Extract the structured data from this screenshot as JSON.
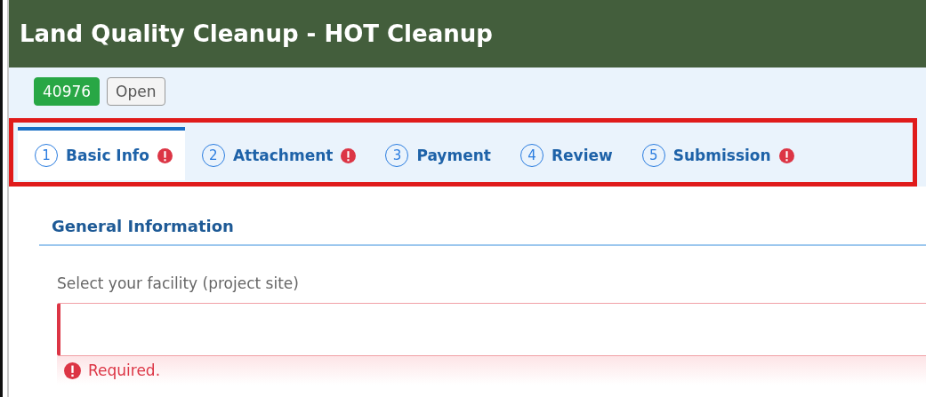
{
  "header": {
    "title": "Land Quality Cleanup - HOT Cleanup"
  },
  "badges": [
    {
      "text": "40976",
      "kind": "id"
    },
    {
      "text": "Open",
      "kind": "status"
    }
  ],
  "tabs": [
    {
      "number": "1",
      "label": "Basic Info",
      "error": true,
      "selected": true
    },
    {
      "number": "2",
      "label": "Attachment",
      "error": true,
      "selected": false
    },
    {
      "number": "3",
      "label": "Payment",
      "error": false,
      "selected": false
    },
    {
      "number": "4",
      "label": "Review",
      "error": false,
      "selected": false
    },
    {
      "number": "5",
      "label": "Submission",
      "error": true,
      "selected": false
    }
  ],
  "section": {
    "title": "General Information"
  },
  "field": {
    "label": "Select your facility (project site)",
    "invalid": true,
    "error": "Required."
  }
}
